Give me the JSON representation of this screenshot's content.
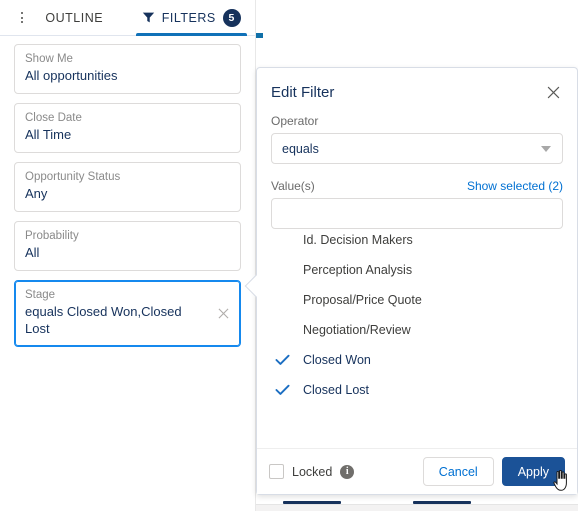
{
  "left_panel": {
    "tabs": [
      {
        "id": "outline",
        "label": "OUTLINE",
        "icon": "list-outline-icon",
        "active": false
      },
      {
        "id": "filters",
        "label": "FILTERS",
        "icon": "funnel-icon",
        "active": true,
        "badge": "5"
      }
    ],
    "filters": [
      {
        "label": "Show Me",
        "value": "All opportunities",
        "selected": false,
        "removable": false
      },
      {
        "label": "Close Date",
        "value": "All Time",
        "selected": false,
        "removable": false
      },
      {
        "label": "Opportunity Status",
        "value": "Any",
        "selected": false,
        "removable": false
      },
      {
        "label": "Probability",
        "value": "All",
        "selected": false,
        "removable": false
      },
      {
        "label": "Stage",
        "value": "equals Closed Won,Closed Lost",
        "selected": true,
        "removable": true,
        "remove_icon": "close-icon"
      }
    ]
  },
  "popover": {
    "title": "Edit Filter",
    "close_icon": "close-icon",
    "operator": {
      "label": "Operator",
      "value": "equals",
      "caret_icon": "chevron-down-icon"
    },
    "values": {
      "label": "Value(s)",
      "show_selected_link": "Show selected (2)",
      "input_value": "",
      "input_placeholder": "",
      "options": [
        {
          "label": "Id. Decision Makers",
          "checked": false
        },
        {
          "label": "Perception Analysis",
          "checked": false
        },
        {
          "label": "Proposal/Price Quote",
          "checked": false
        },
        {
          "label": "Negotiation/Review",
          "checked": false
        },
        {
          "label": "Closed Won",
          "checked": true
        },
        {
          "label": "Closed Lost",
          "checked": true
        }
      ],
      "check_icon": "check-icon"
    },
    "footer": {
      "locked_label": "Locked",
      "locked_checked": false,
      "info_icon": "info-icon",
      "info_glyph": "i",
      "cancel_label": "Cancel",
      "apply_label": "Apply"
    }
  },
  "colors": {
    "brand_blue": "#0070d2",
    "tab_active_underline": "#1071b8",
    "navy": "#16325c",
    "badge_bg": "#16325c",
    "apply_bg": "#1b5297",
    "check_blue": "#1b6ec2",
    "edge_cyan": "#1da7dd",
    "border_gray": "#dddbda"
  },
  "cursor": {
    "type": "pointer-hand-cursor"
  }
}
